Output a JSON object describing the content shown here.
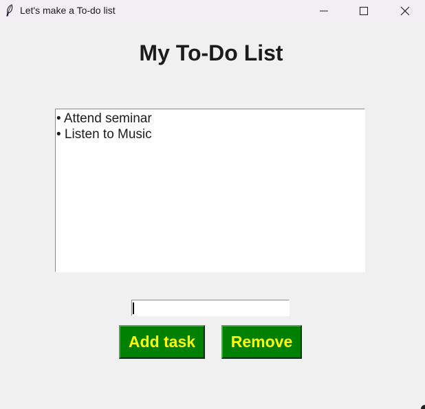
{
  "window": {
    "title": "Let's make a To-do list",
    "controls": {
      "minimize": "minimize-icon",
      "maximize": "maximize-icon",
      "close": "close-icon"
    }
  },
  "main": {
    "heading": "My To-Do List",
    "tasks": [
      "• Attend seminar",
      "• Listen to Music"
    ],
    "task_input": {
      "value": ""
    },
    "buttons": {
      "add_label": "Add task",
      "remove_label": "Remove"
    }
  },
  "colors": {
    "button_bg": "#008000",
    "button_text": "#ffff00",
    "window_bg": "#f0f0f0"
  }
}
